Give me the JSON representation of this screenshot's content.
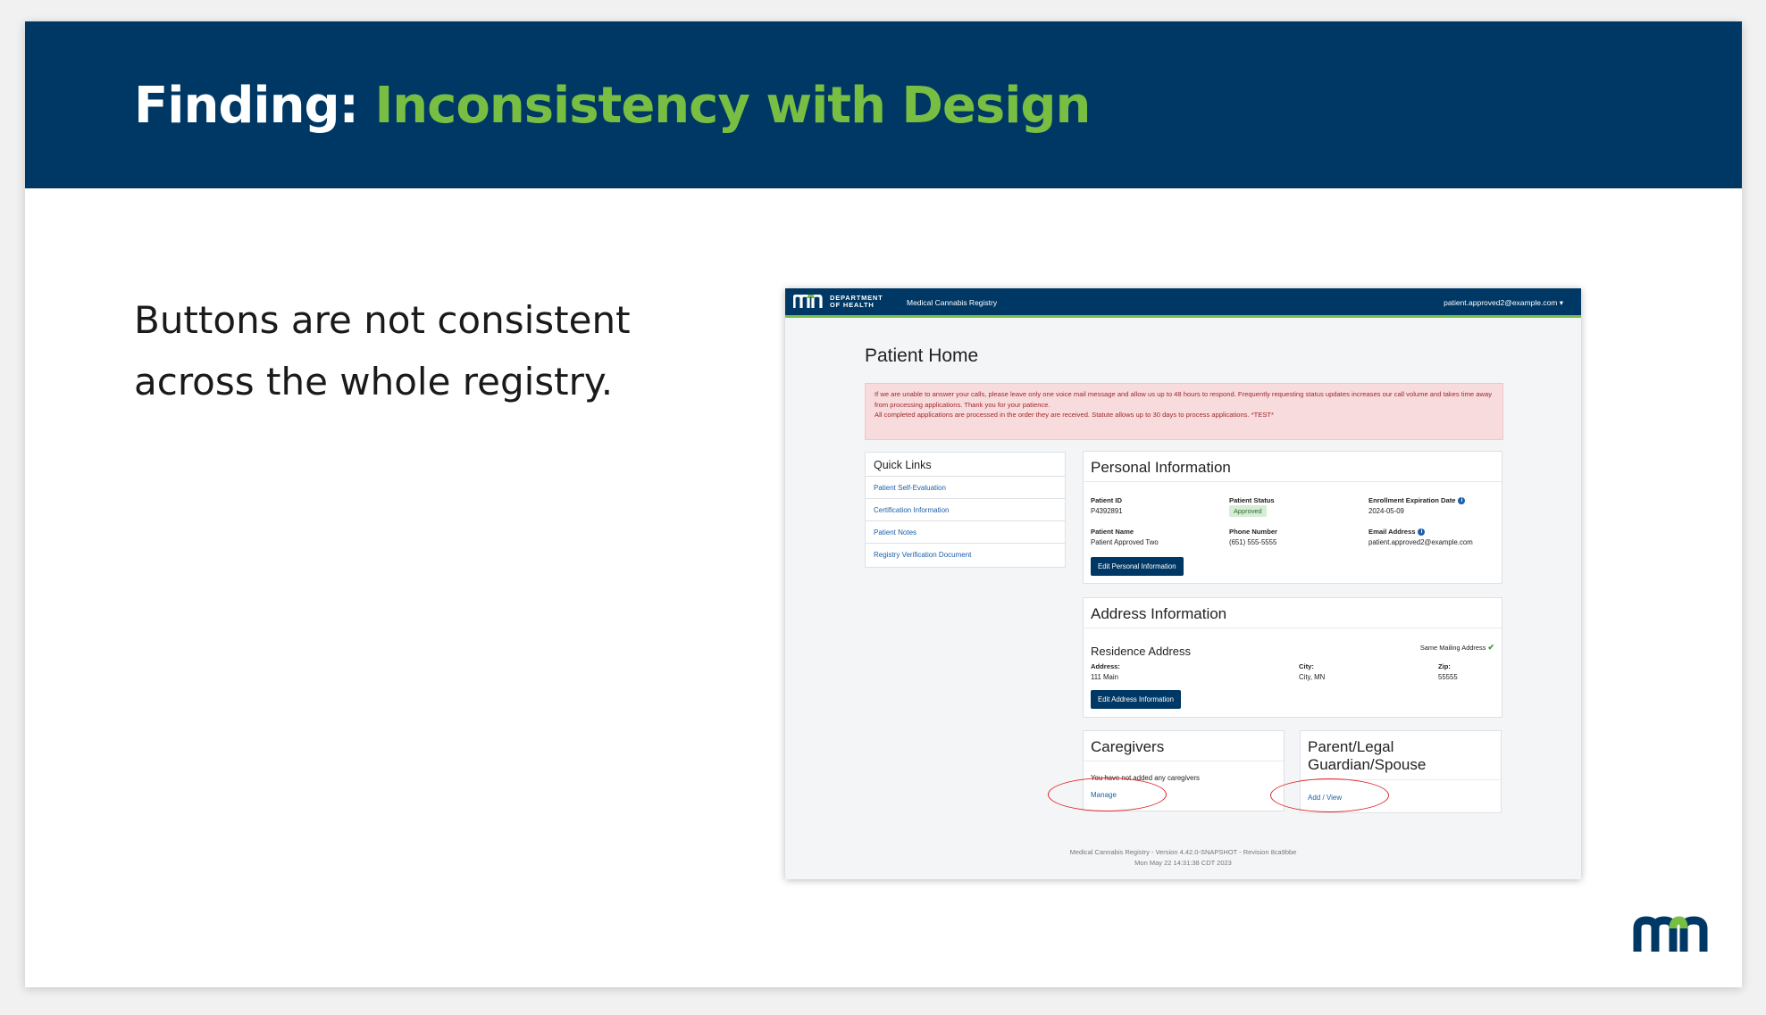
{
  "slide": {
    "title_prefix": "Finding:",
    "title_highlight": "Inconsistency with Design",
    "body_line1": "Buttons are not consistent",
    "body_line2": "across the whole registry.",
    "colors": {
      "header_bg": "#003865",
      "accent_green": "#78be43",
      "annotation_red": "#e0262b"
    }
  },
  "app": {
    "nav": {
      "dept_line1": "DEPARTMENT",
      "dept_line2": "OF HEALTH",
      "app_name": "Medical Cannabis Registry",
      "user_menu": "patient.approved2@example.com ▾"
    },
    "page_title": "Patient Home",
    "alert": {
      "line1": "If we are unable to answer your calls, please leave only one voice mail message and allow us up to 48 hours to respond. Frequently requesting status updates increases our call volume and takes time away from processing applications. Thank you for your patience.",
      "line2": "All completed applications are processed in the order they are received. Statute allows up to 30 days to process applications. *TEST*"
    },
    "quick_links": {
      "title": "Quick Links",
      "items": [
        {
          "label": "Patient Self-Evaluation"
        },
        {
          "label": "Certification Information"
        },
        {
          "label": "Patient Notes"
        },
        {
          "label": "Registry Verification Document"
        }
      ]
    },
    "personal": {
      "title": "Personal Information",
      "patient_id_label": "Patient ID",
      "patient_id": "P4392891",
      "status_label": "Patient Status",
      "status": "Approved",
      "expiration_label": "Enrollment Expiration Date",
      "expiration": "2024-05-09",
      "name_label": "Patient Name",
      "name": "Patient Approved Two",
      "phone_label": "Phone Number",
      "phone": "(651) 555-5555",
      "email_label": "Email Address",
      "email": "patient.approved2@example.com",
      "edit_button": "Edit Personal Information"
    },
    "address": {
      "title": "Address Information",
      "residence_title": "Residence Address",
      "same_mailing": "Same Mailing Address",
      "address_label": "Address:",
      "address": "111 Main",
      "city_label": "City:",
      "city": "City, MN",
      "zip_label": "Zip:",
      "zip": "55555",
      "edit_button": "Edit Address Information"
    },
    "caregivers": {
      "title": "Caregivers",
      "empty_text": "You have not added any caregivers",
      "manage_link": "Manage"
    },
    "guardian": {
      "title_line1": "Parent/Legal",
      "title_line2": "Guardian/Spouse",
      "add_link": "Add / View"
    },
    "footer": {
      "line1": "Medical Cannabis Registry - Version 4.42.0-SNAPSHOT - Revision 8ca9bbe",
      "line2": "Mon May 22 14:31:38 CDT 2023"
    }
  }
}
